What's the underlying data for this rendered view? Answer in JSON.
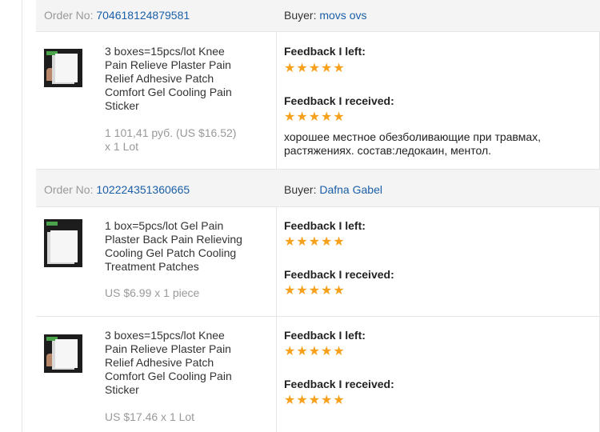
{
  "orders": [
    {
      "order_no_label": "Order No:",
      "order_no": "704618124879581",
      "buyer_label": "Buyer:",
      "buyer": "movs ovs",
      "items": [
        {
          "title": "3 boxes=15pcs/lot Knee Pain Relieve Plaster Pain Relief Adhesive Patch Comfort Gel Cooling Pain Sticker",
          "price": "1 101,41 руб. (US $16.52) x 1 Lot",
          "feedback_left_label": "Feedback I left:",
          "feedback_left_stars": 5,
          "feedback_received_label": "Feedback I received:",
          "feedback_received_stars": 5,
          "comment": "хорошее местное обезболивающие при травмах, растяжениях. состав:ледокаин, ментол."
        }
      ]
    },
    {
      "order_no_label": "Order No:",
      "order_no": "102224351360665",
      "buyer_label": "Buyer:",
      "buyer": "Dafna Gabel",
      "items": [
        {
          "title": "1 box=5pcs/lot Gel Pain Plaster Back Pain Relieving Cooling Gel Patch Cooling Treatment Patches",
          "price": "US $6.99 x 1 piece",
          "feedback_left_label": "Feedback I left:",
          "feedback_left_stars": 5,
          "feedback_received_label": "Feedback I received:",
          "feedback_received_stars": 5
        },
        {
          "title": "3 boxes=15pcs/lot Knee Pain Relieve Plaster Pain Relief Adhesive Patch Comfort Gel Cooling Pain Sticker",
          "price": "US $17.46 x 1 Lot",
          "feedback_left_label": "Feedback I left:",
          "feedback_left_stars": 5,
          "feedback_received_label": "Feedback I received:",
          "feedback_received_stars": 5
        }
      ]
    }
  ],
  "star_color": "#f7a01b",
  "link_color": "#1a5fa8",
  "star_icon": "star-icon"
}
